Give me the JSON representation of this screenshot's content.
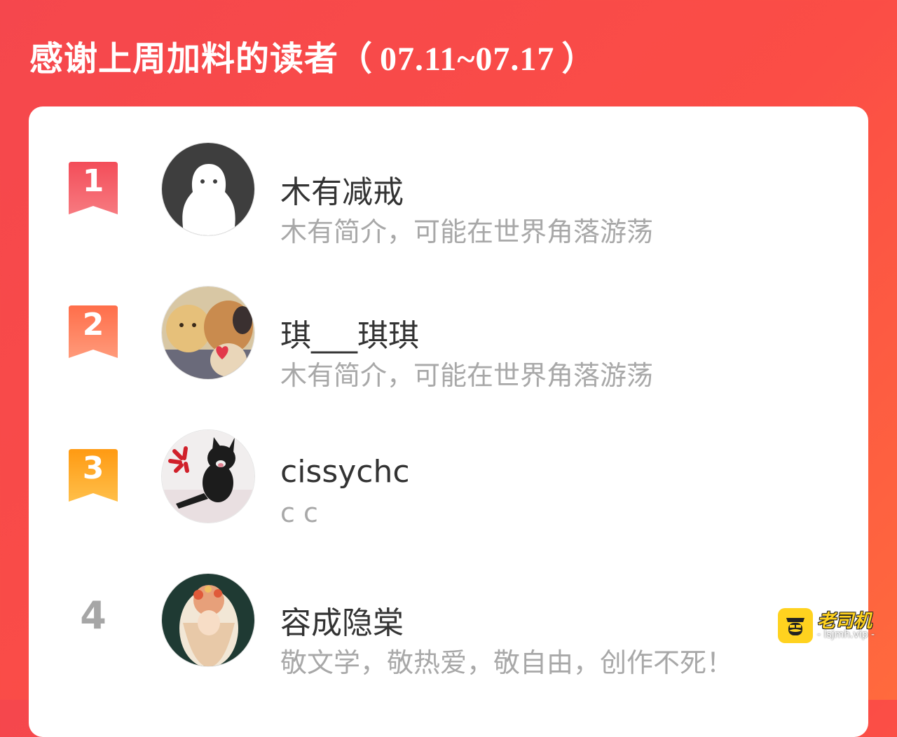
{
  "header": {
    "title": "感谢上周加料的读者",
    "paren_open": "（",
    "date_range": "07.11~07.17",
    "paren_close": "）"
  },
  "colors": {
    "background": "#f5474d",
    "rank1": "#f5555d",
    "rank2": "#ff7d52",
    "rank3": "#ffa21d",
    "rank_plain": "#a6a6a6"
  },
  "readers": [
    {
      "rank": "1",
      "name": "木有减戒",
      "bio": "木有简介，可能在世界角落游荡",
      "avatar": "default-ghost-avatar"
    },
    {
      "rank": "2",
      "name": "琪___琪琪",
      "bio": "木有简介，可能在世界角落游荡",
      "avatar": "teddy-bears-avatar"
    },
    {
      "rank": "3",
      "name": "cissychc",
      "bio": "c c",
      "avatar": "black-cat-avatar"
    },
    {
      "rank": "4",
      "name": "容成隐棠",
      "bio": "敬文学，敬热爱，敬自由，创作不死！",
      "avatar": "illustrated-girl-avatar"
    }
  ],
  "watermark": {
    "icon": "mustache-man-icon",
    "title": "老司机",
    "subtitle": "- lsjmh.vip -"
  }
}
